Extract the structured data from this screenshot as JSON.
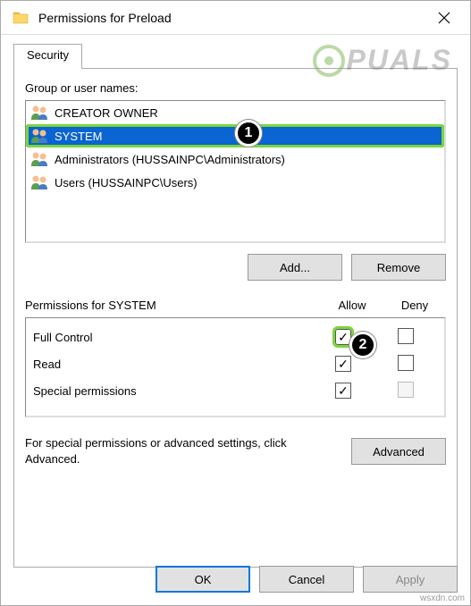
{
  "window": {
    "title": "Permissions for Preload"
  },
  "tab": {
    "label": "Security"
  },
  "groupLabel": "Group or user names:",
  "users": [
    {
      "name": "CREATOR OWNER",
      "selected": false
    },
    {
      "name": "SYSTEM",
      "selected": true
    },
    {
      "name": "Administrators (HUSSAINPC\\Administrators)",
      "selected": false
    },
    {
      "name": "Users (HUSSAINPC\\Users)",
      "selected": false
    }
  ],
  "buttons": {
    "add": "Add...",
    "remove": "Remove",
    "ok": "OK",
    "cancel": "Cancel",
    "apply": "Apply",
    "advanced": "Advanced"
  },
  "permissionsFor": "Permissions for SYSTEM",
  "cols": {
    "allow": "Allow",
    "deny": "Deny"
  },
  "permissions": [
    {
      "name": "Full Control",
      "allow": true,
      "deny": false,
      "highlight": true
    },
    {
      "name": "Read",
      "allow": true,
      "deny": false
    },
    {
      "name": "Special permissions",
      "allow": true,
      "deny": false,
      "denyDisabled": true
    }
  ],
  "advancedText": "For special permissions or advanced settings, click Advanced.",
  "watermark": "PUALS",
  "attribution": "wsxdn.com",
  "markers": {
    "m1": "1",
    "m2": "2"
  }
}
